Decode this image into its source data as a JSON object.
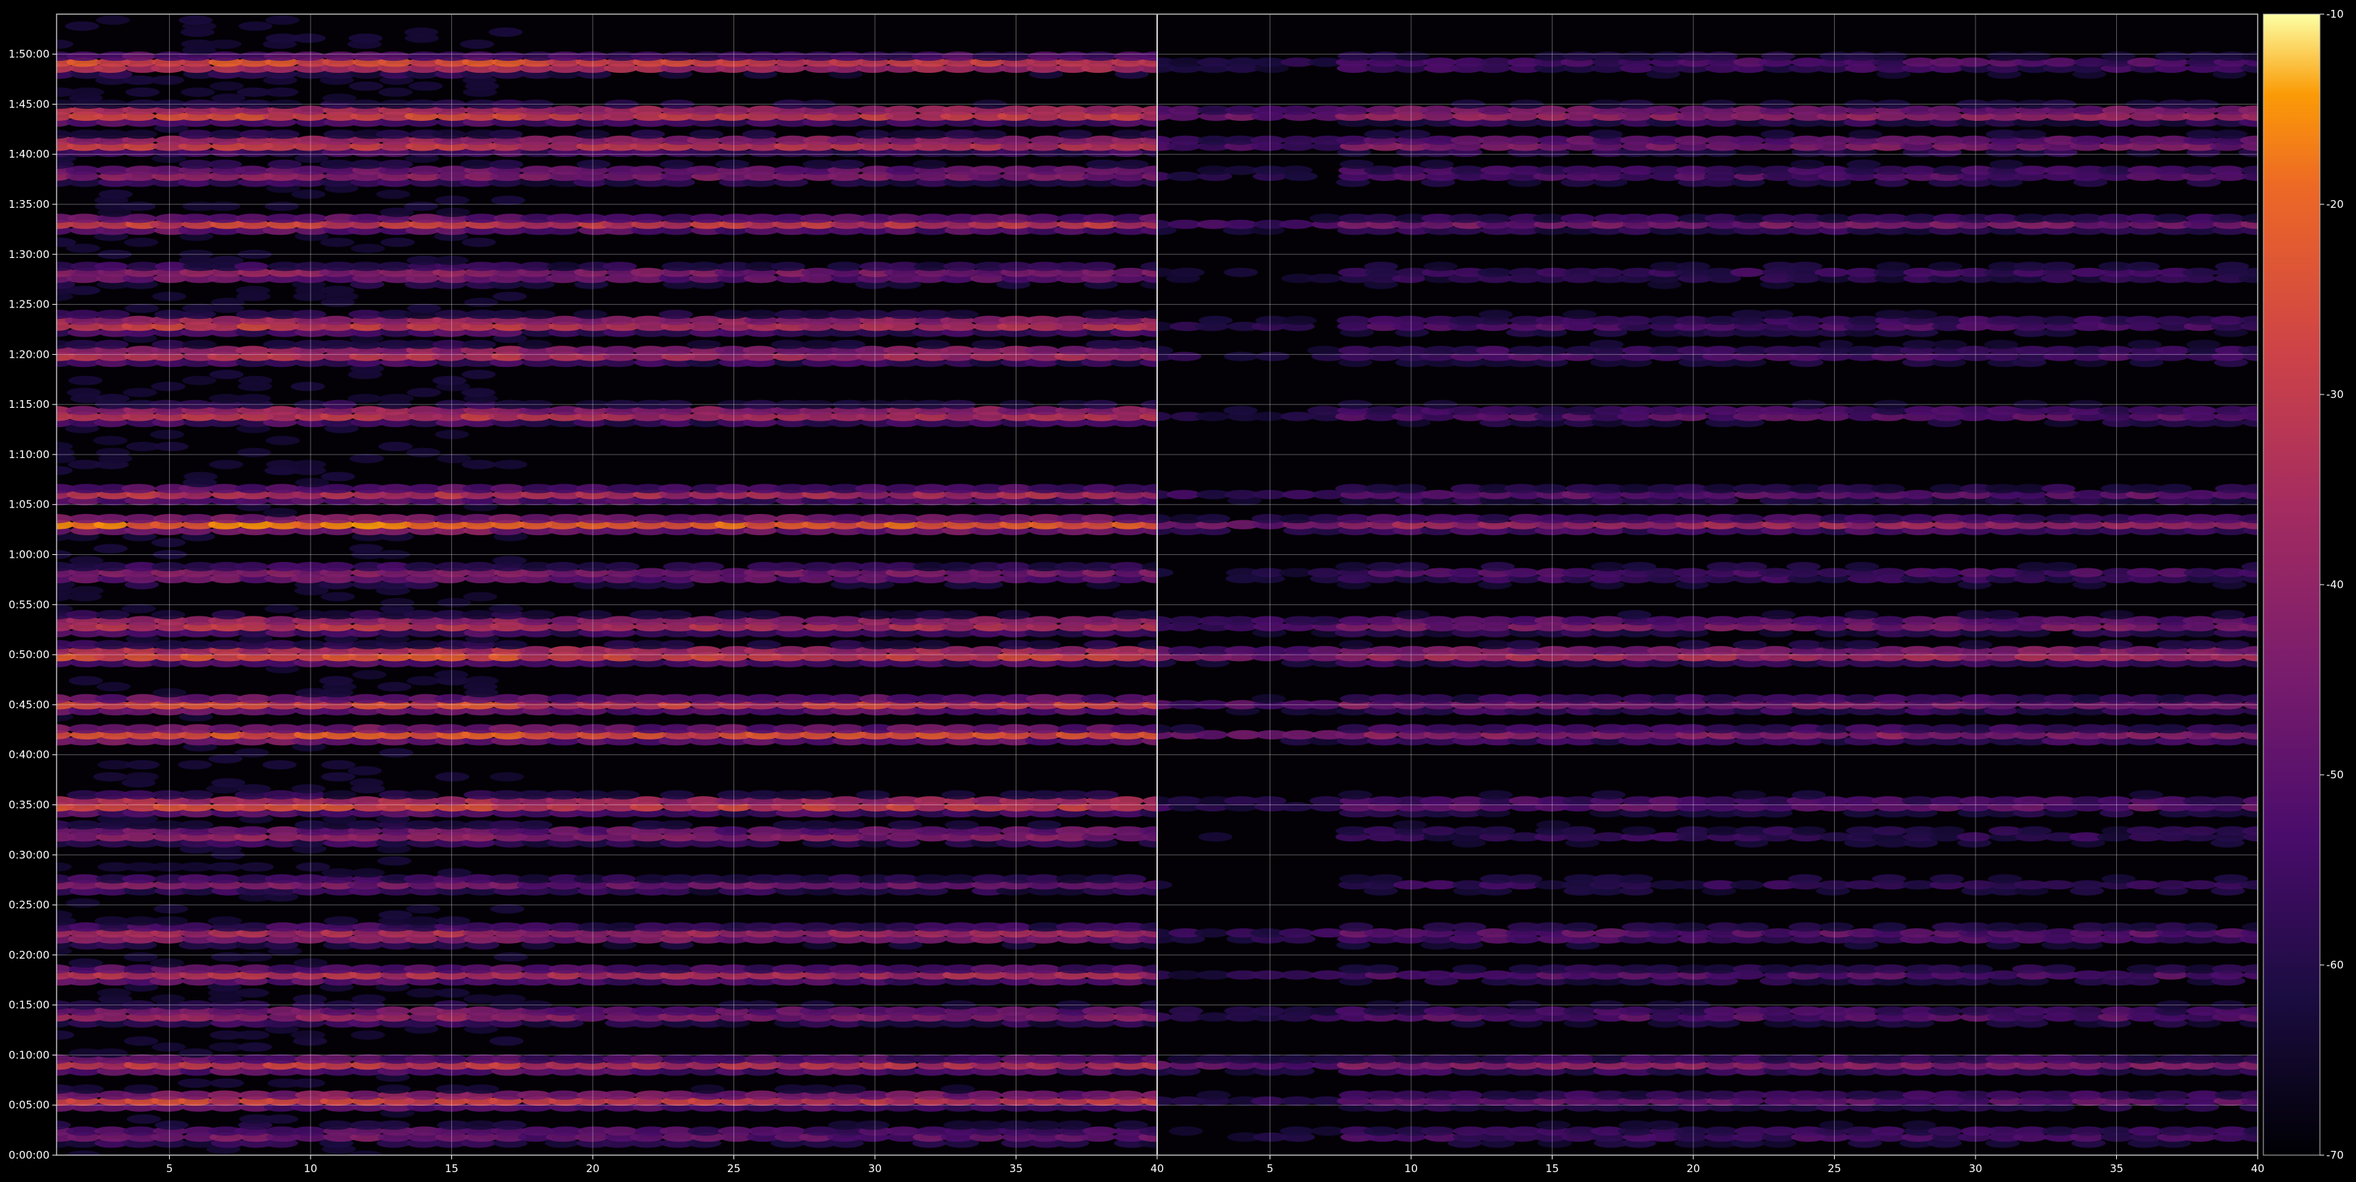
{
  "chart_data": {
    "type": "heatmap",
    "panels": 2,
    "xlim": [
      1,
      40
    ],
    "x_ticks": [
      5,
      10,
      15,
      20,
      25,
      30,
      35,
      40
    ],
    "y_seconds_range": [
      0,
      6840
    ],
    "y_ticks": [
      "0:00:00",
      "0:05:00",
      "0:10:00",
      "0:15:00",
      "0:20:00",
      "0:25:00",
      "0:30:00",
      "0:35:00",
      "0:40:00",
      "0:45:00",
      "0:50:00",
      "0:55:00",
      "1:00:00",
      "1:05:00",
      "1:10:00",
      "1:15:00",
      "1:20:00",
      "1:25:00",
      "1:30:00",
      "1:35:00",
      "1:40:00",
      "1:45:00",
      "1:50:00"
    ],
    "colorbar": {
      "min": -70,
      "max": -10,
      "ticks": [
        -10,
        -20,
        -30,
        -40,
        -50,
        -60,
        -70
      ],
      "colormap": "inferno"
    },
    "grid": true,
    "band_profile": [
      {
        "t": "0:02:00",
        "level_left": -45,
        "level_right": -52
      },
      {
        "t": "0:05:30",
        "level_left": -28,
        "level_right": -48
      },
      {
        "t": "0:09:00",
        "level_left": -34,
        "level_right": -42
      },
      {
        "t": "0:14:00",
        "level_left": -38,
        "level_right": -48
      },
      {
        "t": "0:18:00",
        "level_left": -36,
        "level_right": -52
      },
      {
        "t": "0:22:00",
        "level_left": -32,
        "level_right": -46
      },
      {
        "t": "0:27:00",
        "level_left": -48,
        "level_right": -58
      },
      {
        "t": "0:32:00",
        "level_left": -38,
        "level_right": -56
      },
      {
        "t": "0:35:00",
        "level_left": -22,
        "level_right": -46
      },
      {
        "t": "0:42:00",
        "level_left": -26,
        "level_right": -42
      },
      {
        "t": "0:45:00",
        "level_left": -30,
        "level_right": -44
      },
      {
        "t": "0:50:00",
        "level_left": -20,
        "level_right": -30
      },
      {
        "t": "0:53:00",
        "level_left": -28,
        "level_right": -40
      },
      {
        "t": "0:58:00",
        "level_left": -40,
        "level_right": -50
      },
      {
        "t": "1:03:00",
        "level_left": -22,
        "level_right": -38
      },
      {
        "t": "1:06:00",
        "level_left": -36,
        "level_right": -50
      },
      {
        "t": "1:14:00",
        "level_left": -28,
        "level_right": -48
      },
      {
        "t": "1:20:00",
        "level_left": -30,
        "level_right": -50
      },
      {
        "t": "1:23:00",
        "level_left": -26,
        "level_right": -50
      },
      {
        "t": "1:28:00",
        "level_left": -40,
        "level_right": -54
      },
      {
        "t": "1:33:00",
        "level_left": -32,
        "level_right": -46
      },
      {
        "t": "1:38:00",
        "level_left": -40,
        "level_right": -48
      },
      {
        "t": "1:41:00",
        "level_left": -26,
        "level_right": -40
      },
      {
        "t": "1:44:00",
        "level_left": -22,
        "level_right": -34
      },
      {
        "t": "1:49:00",
        "level_left": -20,
        "level_right": -50
      }
    ]
  }
}
